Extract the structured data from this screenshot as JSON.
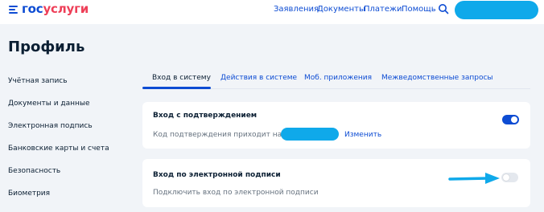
{
  "header": {
    "logo_prefix": "гос",
    "logo_suffix": "услуги",
    "nav": [
      "Заявления",
      "Документы",
      "Платежи",
      "Помощь"
    ]
  },
  "page": {
    "title": "Профиль"
  },
  "sidebar": {
    "items": [
      {
        "label": "Учётная запись"
      },
      {
        "label": "Документы и данные"
      },
      {
        "label": "Электронная подпись"
      },
      {
        "label": "Банковские карты и счета"
      },
      {
        "label": "Безопасность"
      },
      {
        "label": "Биометрия"
      }
    ]
  },
  "tabs": [
    {
      "label": "Вход в систему",
      "active": true
    },
    {
      "label": "Действия в системе"
    },
    {
      "label": "Моб. приложения"
    },
    {
      "label": "Межведомственные запросы"
    }
  ],
  "cards": {
    "confirm": {
      "title": "Вход с подтверждением",
      "subtitle": "Код подтверждения приходит на номер",
      "link": "Изменить",
      "toggle_on": true
    },
    "signature": {
      "title": "Вход по электронной подписи",
      "subtitle": "Подключить вход по электронной подписи",
      "toggle_on": false
    }
  },
  "colors": {
    "brand": "#0d4cd3",
    "accent_red": "#ee3f58",
    "highlight": "#0fa9ea",
    "background": "#f1f4f8"
  }
}
